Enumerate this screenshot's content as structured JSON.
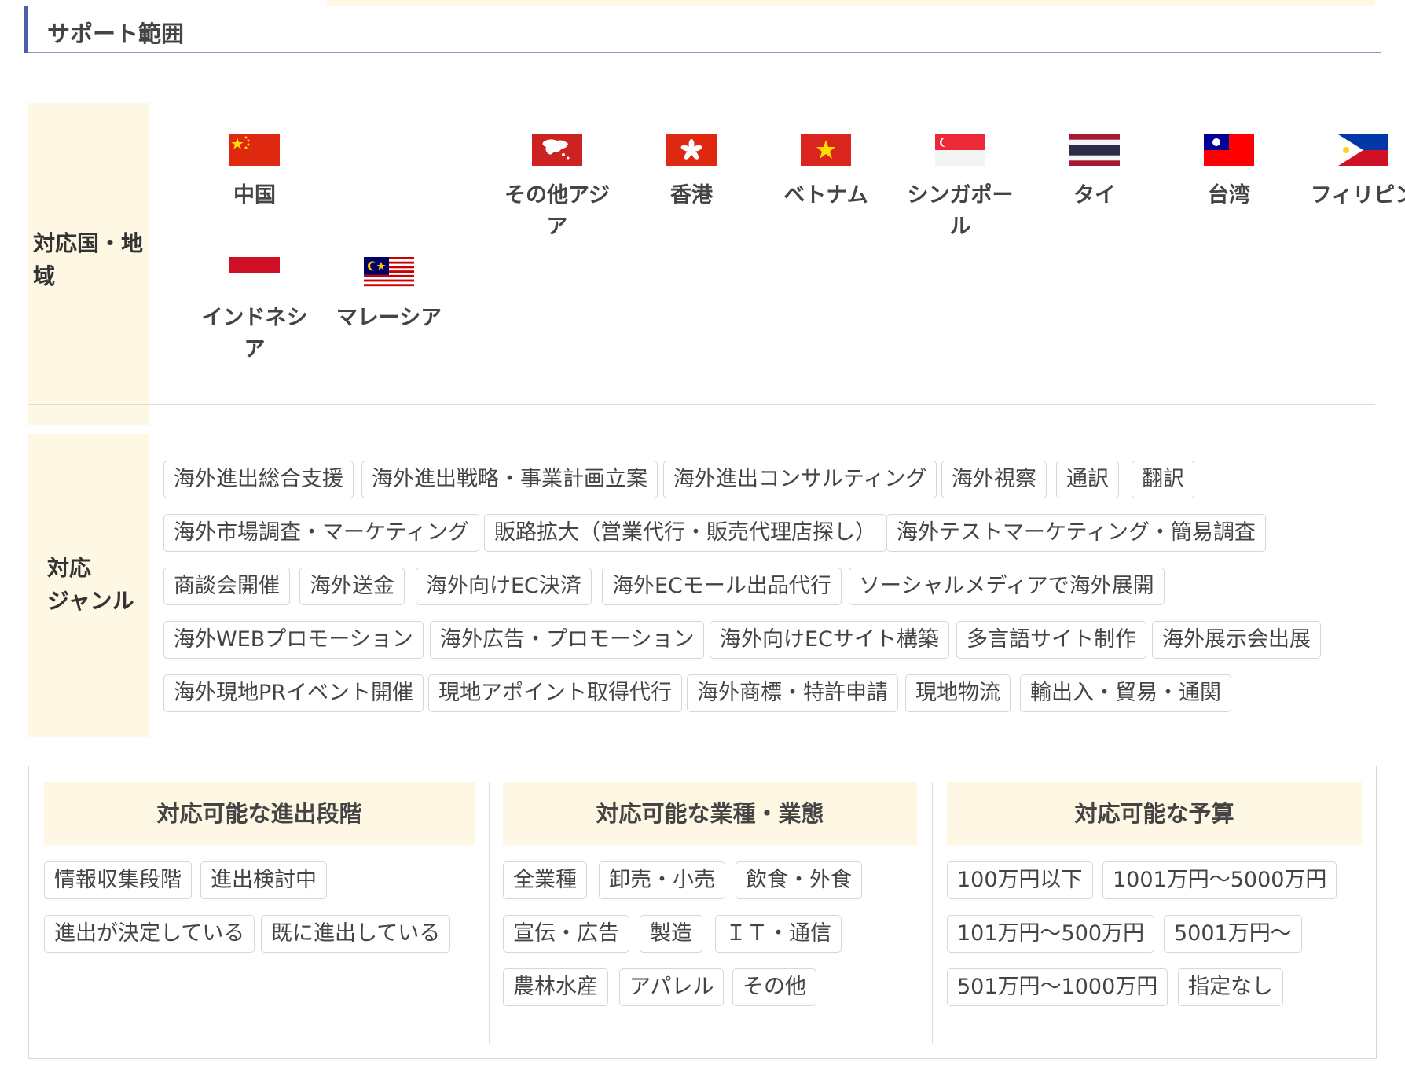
{
  "section": {
    "title": "サポート範囲"
  },
  "countries": {
    "label": "対応国・地域",
    "items": [
      {
        "name": "中国"
      },
      {
        "name": "その他アジア"
      },
      {
        "name": "香港"
      },
      {
        "name": "ベトナム"
      },
      {
        "name": "シンガポール"
      },
      {
        "name": "タイ"
      },
      {
        "name": "台湾"
      },
      {
        "name": "フィリピン"
      },
      {
        "name": "インドネシア"
      },
      {
        "name": "マレーシア"
      }
    ]
  },
  "genres": {
    "label_line1": "対応",
    "label_line2": "ジャンル",
    "tags": [
      "海外進出総合支援",
      "海外進出戦略・事業計画立案",
      "海外進出コンサルティング",
      "海外視察",
      "通訳",
      "翻訳",
      "海外市場調査・マーケティング",
      "販路拡大（営業代行・販売代理店探し）",
      "海外テストマーケティング・簡易調査",
      "商談会開催",
      "海外送金",
      "海外向けEC決済",
      "海外ECモール出品代行",
      "ソーシャルメディアで海外展開",
      "海外WEBプロモーション",
      "海外広告・プロモーション",
      "海外向けECサイト構築",
      "多言語サイト制作",
      "海外展示会出展",
      "海外現地PRイベント開催",
      "現地アポイント取得代行",
      "海外商標・特許申請",
      "現地物流",
      "輸出入・貿易・通関"
    ]
  },
  "stages": {
    "title": "対応可能な進出段階",
    "tags": [
      "情報収集段階",
      "進出検討中",
      "進出が決定している",
      "既に進出している"
    ]
  },
  "industries": {
    "title": "対応可能な業種・業態",
    "tags": [
      "全業種",
      "卸売・小売",
      "飲食・外食",
      "宣伝・広告",
      "製造",
      "ＩＴ・通信",
      "農林水産",
      "アパレル",
      "その他"
    ]
  },
  "budgets": {
    "title": "対応可能な予算",
    "tags": [
      "100万円以下",
      "1001万円〜5000万円",
      "101万円〜500万円",
      "5001万円〜",
      "501万円〜1000万円",
      "指定なし"
    ]
  }
}
